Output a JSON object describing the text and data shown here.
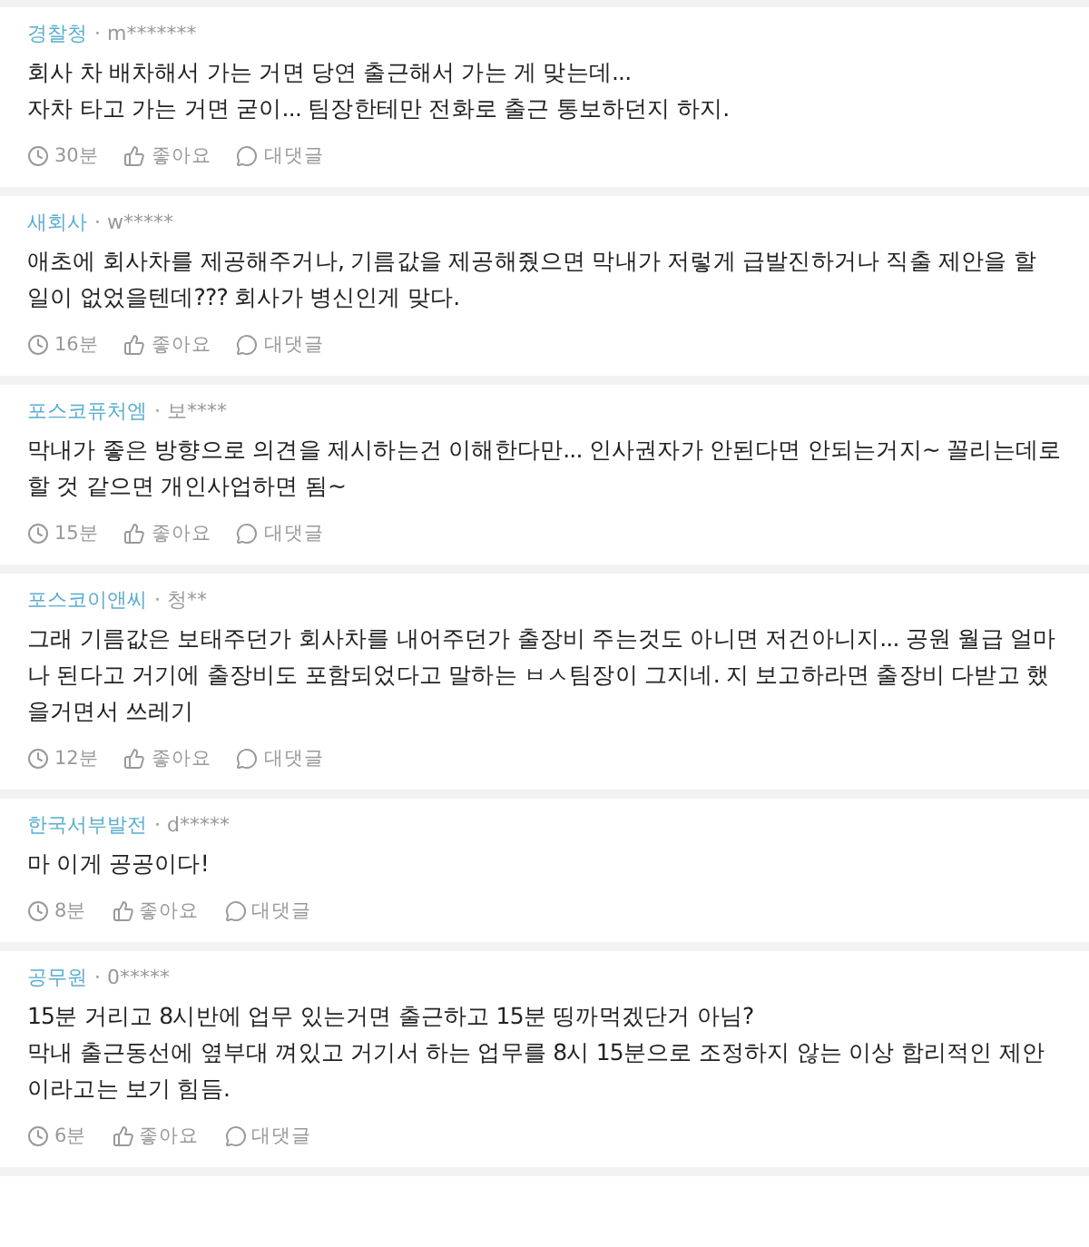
{
  "comments": [
    {
      "company": "경찰청",
      "user": "· m*******",
      "paragraphs": [
        "회사 차 배차해서 가는 거면 당연 출근해서 가는 게 맞는데...",
        "자차 타고 가는 거면 굳이... 팀장한테만 전화로 출근 통보하던지 하지."
      ],
      "time": "30분",
      "like": "좋아요",
      "reply": "대댓글"
    },
    {
      "company": "새회사",
      "user": "· w*****",
      "paragraphs": [
        "애초에 회사차를 제공해주거나, 기름값을 제공해줬으면 막내가 저렇게 급발진하거나 직출 제안을 할 일이 없었을텐데??? 회사가 병신인게 맞다."
      ],
      "time": "16분",
      "like": "좋아요",
      "reply": "대댓글"
    },
    {
      "company": "포스코퓨처엠",
      "user": "· 보****",
      "paragraphs": [
        "막내가 좋은 방향으로 의견을 제시하는건 이해한다만... 인사권자가 안된다면 안되는거지~ 꼴리는데로 할 것 같으면 개인사업하면 됨~"
      ],
      "time": "15분",
      "like": "좋아요",
      "reply": "대댓글"
    },
    {
      "company": "포스코이앤씨",
      "user": "· 청**",
      "paragraphs": [
        "그래 기름값은 보태주던가 회사차를 내어주던가 출장비 주는것도 아니면 저건아니지... 공원 월급 얼마나 된다고 거기에 출장비도 포함되었다고 말하는 ㅂㅅ팀장이 그지네. 지 보고하라면 출장비 다받고 했을거면서 쓰레기"
      ],
      "time": "12분",
      "like": "좋아요",
      "reply": "대댓글"
    },
    {
      "company": "한국서부발전",
      "user": "· d*****",
      "paragraphs": [
        "마 이게 공공이다!"
      ],
      "time": "8분",
      "like": "좋아요",
      "reply": "대댓글"
    },
    {
      "company": "공무원",
      "user": "· 0*****",
      "paragraphs": [
        "15분 거리고 8시반에 업무 있는거면 출근하고 15분 띵까먹겠단거 아님?",
        "막내 출근동선에 옆부대 껴있고 거기서 하는 업무를 8시 15분으로 조정하지 않는 이상 합리적인 제안이라고는 보기 힘듬."
      ],
      "time": "6분",
      "like": "좋아요",
      "reply": "대댓글"
    }
  ]
}
